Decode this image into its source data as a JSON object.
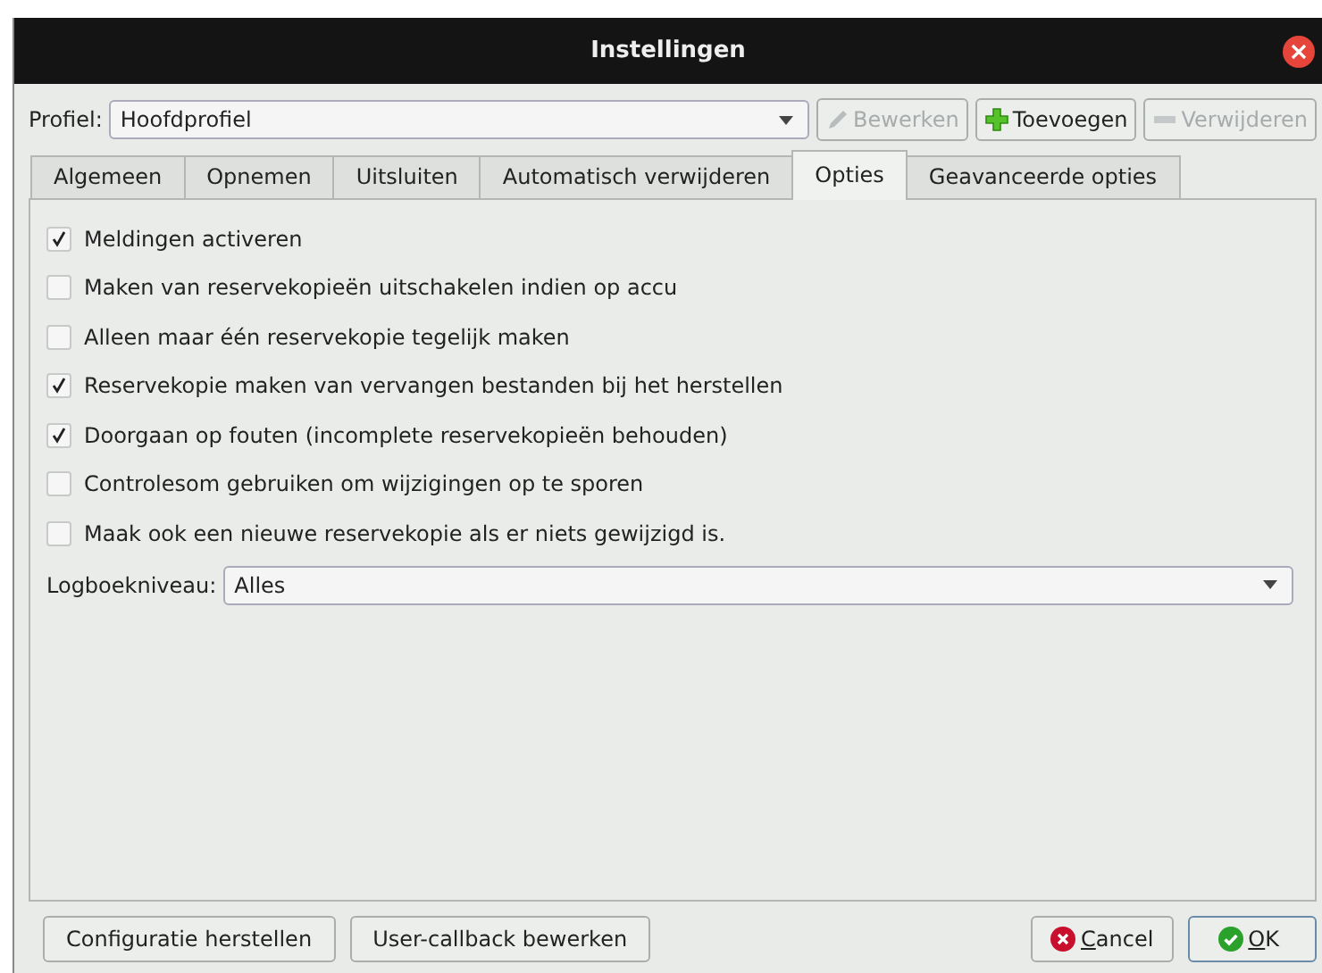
{
  "window": {
    "title": "Instellingen"
  },
  "profile": {
    "label": "Profiel:",
    "value": "Hoofdprofiel"
  },
  "profile_buttons": [
    {
      "label": "Bewerken",
      "kind": "edit",
      "disabled": true
    },
    {
      "label": "Toevoegen",
      "kind": "add",
      "disabled": false
    },
    {
      "label": "Verwijderen",
      "kind": "remove",
      "disabled": true
    }
  ],
  "tabs": [
    {
      "label": "Algemeen",
      "selected": false
    },
    {
      "label": "Opnemen",
      "selected": false
    },
    {
      "label": "Uitsluiten",
      "selected": false
    },
    {
      "label": "Automatisch verwijderen",
      "selected": false
    },
    {
      "label": "Opties",
      "selected": true
    },
    {
      "label": "Geavanceerde opties",
      "selected": false
    }
  ],
  "options": [
    {
      "label": "Meldingen activeren",
      "checked": true
    },
    {
      "label": "Maken van reservekopieën uitschakelen indien op accu",
      "checked": false
    },
    {
      "label": "Alleen maar één reservekopie tegelijk maken",
      "checked": false
    },
    {
      "label": "Reservekopie maken van vervangen bestanden bij het herstellen",
      "checked": true
    },
    {
      "label": "Doorgaan op fouten (incomplete reservekopieën behouden)",
      "checked": true
    },
    {
      "label": "Controlesom gebruiken om wijzigingen op te sporen",
      "checked": false
    },
    {
      "label": "Maak ook een nieuwe reservekopie als er niets gewijzigd is.",
      "checked": false
    }
  ],
  "log_level": {
    "label": "Logboekniveau:",
    "value": "Alles"
  },
  "footer_left": [
    {
      "label": "Configuratie herstellen"
    },
    {
      "label": "User-callback bewerken"
    }
  ],
  "footer_right": [
    {
      "label": "Cancel",
      "kind": "cancel",
      "underline_first": true,
      "default": false
    },
    {
      "label": "OK",
      "kind": "ok",
      "underline_first": true,
      "default": true
    }
  ]
}
